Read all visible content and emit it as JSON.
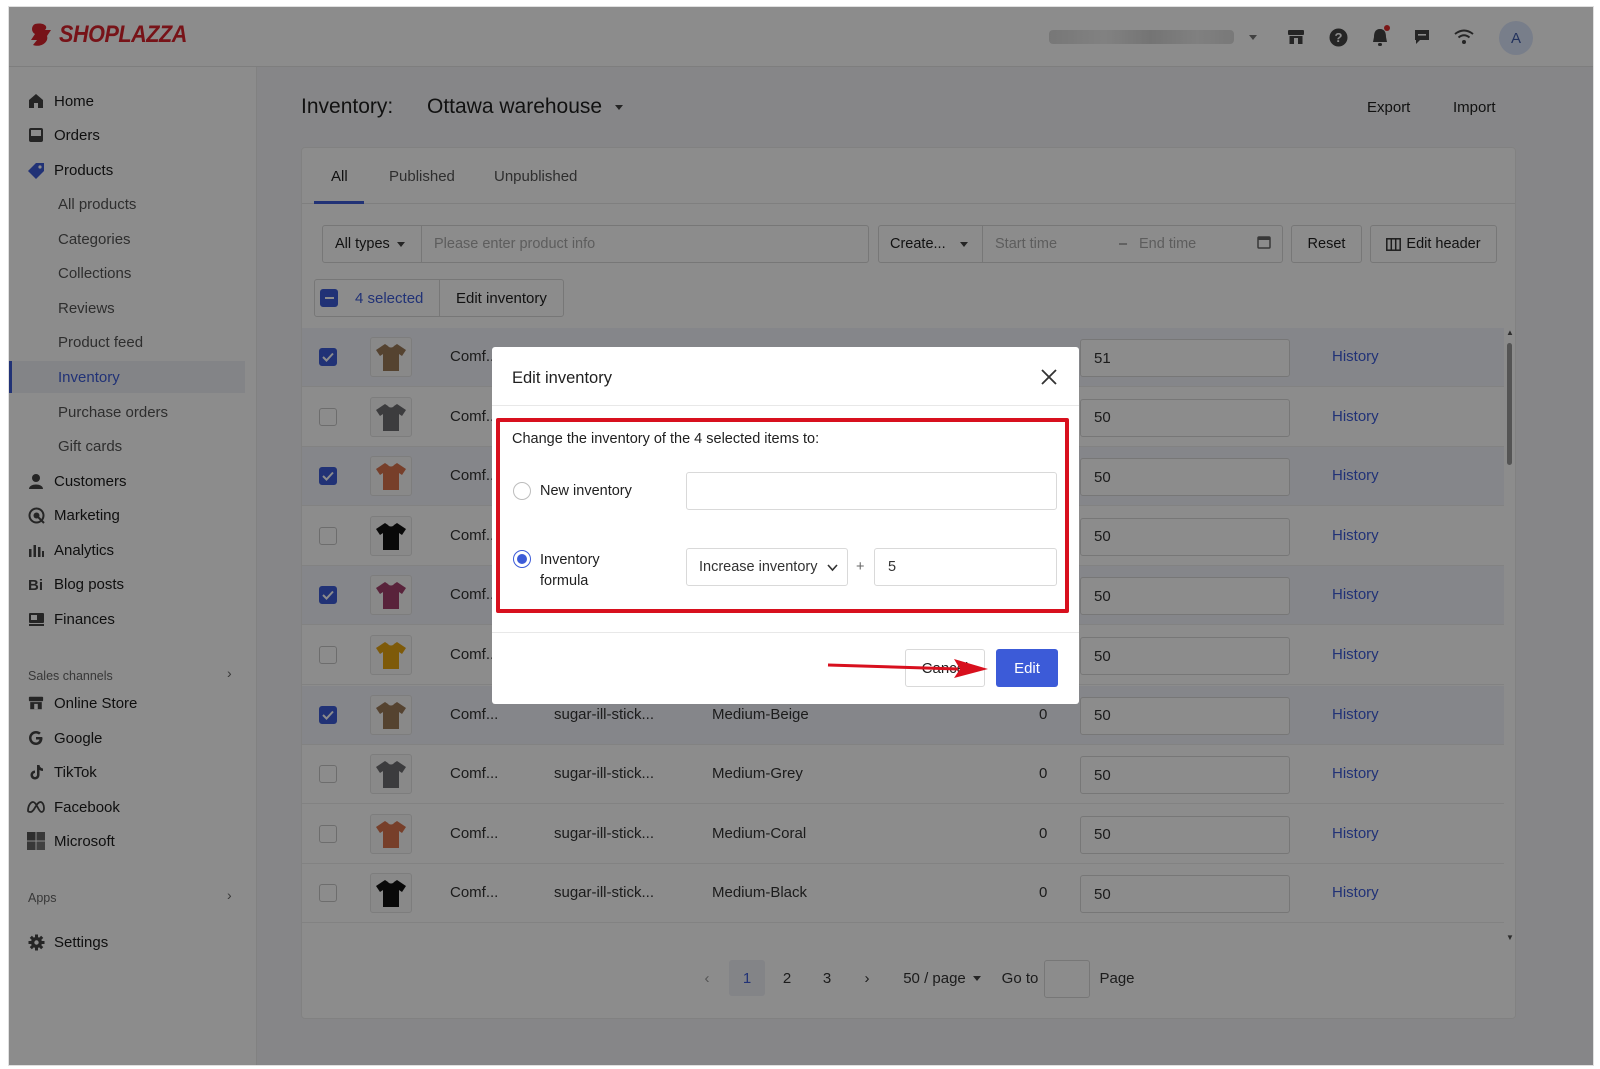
{
  "brand": {
    "name": "SHOPLAZZA",
    "color": "#d9232d",
    "accent": "#3c5bd8"
  },
  "topbar": {
    "icons": [
      "store-icon",
      "help-icon",
      "bell-icon",
      "message-icon",
      "wifi-icon"
    ],
    "avatar_initial": "A"
  },
  "sidebar": {
    "items": [
      {
        "label": "Home",
        "icon": "home-icon"
      },
      {
        "label": "Orders",
        "icon": "orders-icon"
      },
      {
        "label": "Products",
        "icon": "tag-icon"
      },
      {
        "label": "All products"
      },
      {
        "label": "Categories"
      },
      {
        "label": "Collections"
      },
      {
        "label": "Reviews"
      },
      {
        "label": "Product feed"
      },
      {
        "label": "Inventory",
        "active": true
      },
      {
        "label": "Purchase orders"
      },
      {
        "label": "Gift cards"
      },
      {
        "label": "Customers",
        "icon": "user-icon"
      },
      {
        "label": "Marketing",
        "icon": "marketing-icon"
      },
      {
        "label": "Analytics",
        "icon": "analytics-icon"
      },
      {
        "label": "Blog posts",
        "icon": "blog-icon"
      },
      {
        "label": "Finances",
        "icon": "finances-icon"
      }
    ],
    "sales_channels_label": "Sales channels",
    "channels": [
      {
        "label": "Online Store",
        "icon": "store-icon"
      },
      {
        "label": "Google",
        "icon": "google-icon"
      },
      {
        "label": "TikTok",
        "icon": "tiktok-icon"
      },
      {
        "label": "Facebook",
        "icon": "facebook-icon"
      },
      {
        "label": "Microsoft",
        "icon": "microsoft-icon"
      }
    ],
    "apps_label": "Apps",
    "settings_label": "Settings"
  },
  "header": {
    "title": "Inventory:",
    "warehouse": "Ottawa warehouse",
    "export_label": "Export",
    "import_label": "Import"
  },
  "tabs": [
    {
      "label": "All"
    },
    {
      "label": "Published"
    },
    {
      "label": "Unpublished"
    }
  ],
  "filters": {
    "type_label": "All types",
    "search_placeholder": "Please enter product info",
    "create_label": "Create...",
    "start_placeholder": "Start time",
    "range_sep": "–",
    "end_placeholder": "End time",
    "reset_label": "Reset",
    "edit_header_label": "Edit header"
  },
  "selection": {
    "count_label": "4 selected",
    "edit_inventory_label": "Edit inventory"
  },
  "rows": [
    {
      "checked": true,
      "color": "#9c7a58",
      "product": "Comf...",
      "sku": "",
      "variant": "",
      "qty": "",
      "inventory": "51",
      "history": "History"
    },
    {
      "checked": false,
      "color": "#6e6e72",
      "product": "Comf...",
      "sku": "",
      "variant": "",
      "qty": "",
      "inventory": "50",
      "history": "History"
    },
    {
      "checked": true,
      "color": "#d9744e",
      "product": "Comf...",
      "sku": "",
      "variant": "",
      "qty": "",
      "inventory": "50",
      "history": "History"
    },
    {
      "checked": false,
      "color": "#121212",
      "product": "Comf...",
      "sku": "",
      "variant": "",
      "qty": "",
      "inventory": "50",
      "history": "History"
    },
    {
      "checked": true,
      "color": "#a2406c",
      "product": "Comf...",
      "sku": "",
      "variant": "",
      "qty": "",
      "inventory": "50",
      "history": "History"
    },
    {
      "checked": false,
      "color": "#e6a412",
      "product": "Comf...",
      "sku": "",
      "variant": "",
      "qty": "",
      "inventory": "50",
      "history": "History"
    },
    {
      "checked": true,
      "color": "#9c7a58",
      "product": "Comf...",
      "sku": "sugar-ill-stick...",
      "variant": "Medium-Beige",
      "qty": "0",
      "inventory": "50",
      "history": "History"
    },
    {
      "checked": false,
      "color": "#6e6e72",
      "product": "Comf...",
      "sku": "sugar-ill-stick...",
      "variant": "Medium-Grey",
      "qty": "0",
      "inventory": "50",
      "history": "History"
    },
    {
      "checked": false,
      "color": "#d9744e",
      "product": "Comf...",
      "sku": "sugar-ill-stick...",
      "variant": "Medium-Coral",
      "qty": "0",
      "inventory": "50",
      "history": "History"
    },
    {
      "checked": false,
      "color": "#121212",
      "product": "Comf...",
      "sku": "sugar-ill-stick...",
      "variant": "Medium-Black",
      "qty": "0",
      "inventory": "50",
      "history": "History"
    }
  ],
  "pagination": {
    "pages": [
      "1",
      "2",
      "3"
    ],
    "active_page": "1",
    "page_size_label": "50 / page",
    "goto_label": "Go to",
    "page_suffix": "Page"
  },
  "modal": {
    "title": "Edit inventory",
    "description": "Change the inventory of the 4 selected items to:",
    "option_new_label": "New inventory",
    "new_inventory_value": "",
    "option_formula_line1": "Inventory",
    "option_formula_line2": "formula",
    "formula_mode": "Increase inventory",
    "operator": "+",
    "formula_value": "5",
    "cancel_label": "Cancel",
    "edit_label": "Edit",
    "highlight_color": "#d8101e"
  }
}
